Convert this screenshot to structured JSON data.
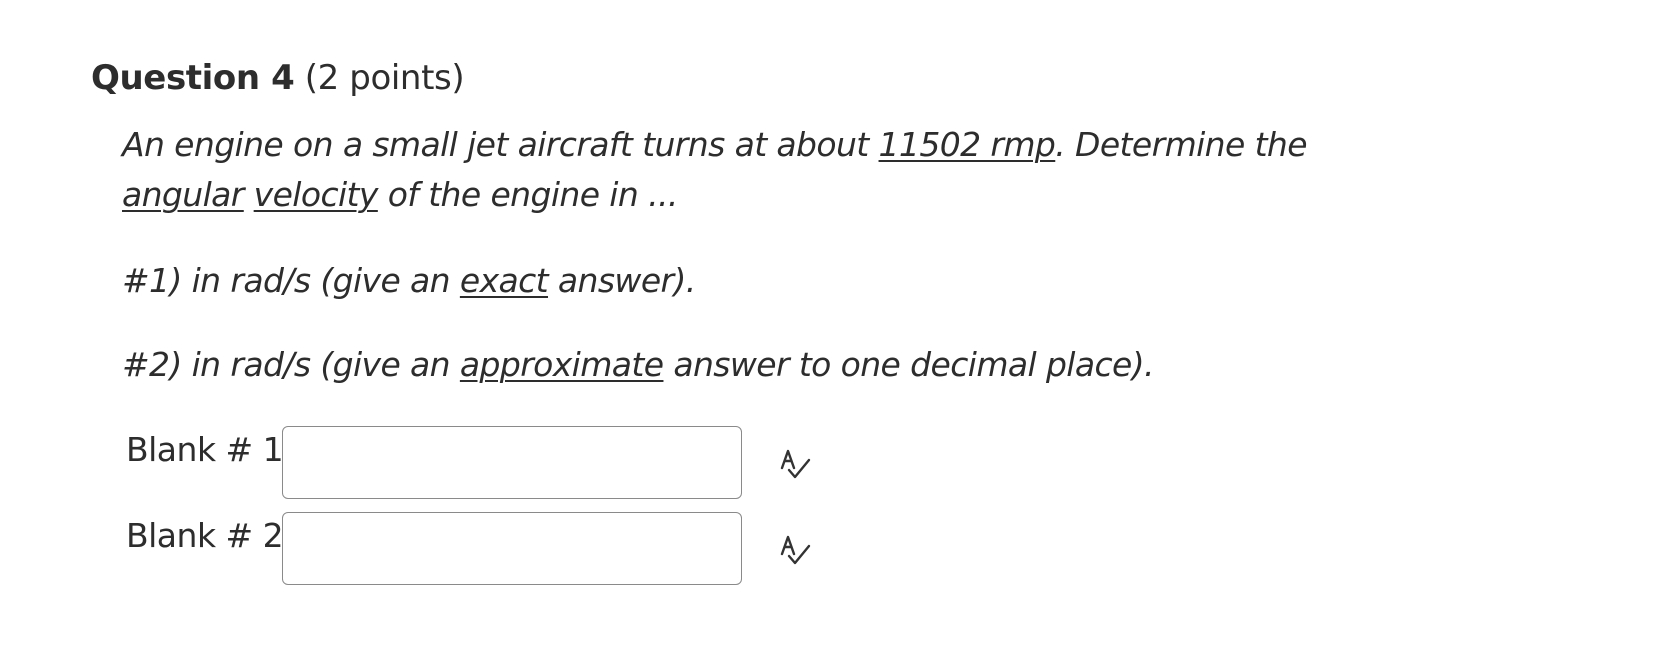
{
  "question": {
    "title": "Question 4",
    "points": "(2 points)",
    "prompt": {
      "part1": "An engine on a small jet aircraft turns at about ",
      "rpm_value": "11502 rmp",
      "part2": ".  Determine the ",
      "term_angular": "angular",
      "term_velocity": "velocity",
      "part3": " of the engine in ..."
    },
    "subq1": {
      "prefix": "#1) in rad/s (give an ",
      "emphasis": "exact",
      "suffix": " answer)."
    },
    "subq2": {
      "prefix": "#2) in rad/s (give an ",
      "emphasis": "approximate",
      "suffix": " answer to one decimal place)."
    }
  },
  "blanks": [
    {
      "label": "Blank # 1",
      "value": "",
      "icon": "spellcheck-icon"
    },
    {
      "label": "Blank # 2",
      "value": "",
      "icon": "spellcheck-icon"
    }
  ],
  "colors": {
    "text": "#2d2d2d",
    "input_border": "#8a8a8a",
    "icon": "#333333"
  }
}
